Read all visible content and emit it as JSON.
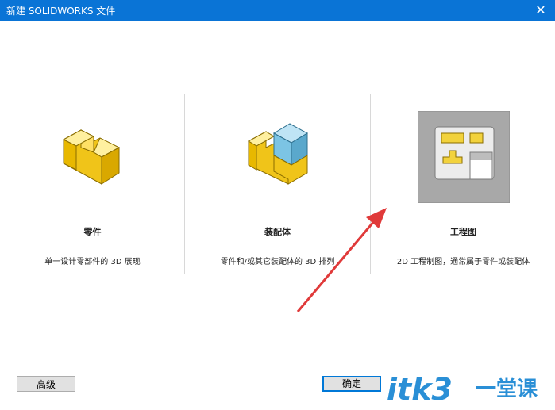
{
  "window": {
    "title": "新建 SOLIDWORKS 文件",
    "close_glyph": "✕"
  },
  "templates": [
    {
      "label": "零件",
      "description": "单一设计零部件的 3D 展现"
    },
    {
      "label": "装配体",
      "description": "零件和/或其它装配体的 3D 排列"
    },
    {
      "label": "工程图",
      "description": "2D 工程制图，通常属于零件或装配体"
    }
  ],
  "buttons": {
    "advanced": "高级",
    "ok": "确定"
  },
  "watermark": {
    "text": "itk3",
    "suffix": "一堂课"
  },
  "colors": {
    "titlebar": "#0a74d6",
    "part_yellow": "#f2d23c",
    "assembly_blue": "#7cc4e4",
    "annotation_arrow": "#e03a3a",
    "watermark": "#2a8fd6"
  }
}
